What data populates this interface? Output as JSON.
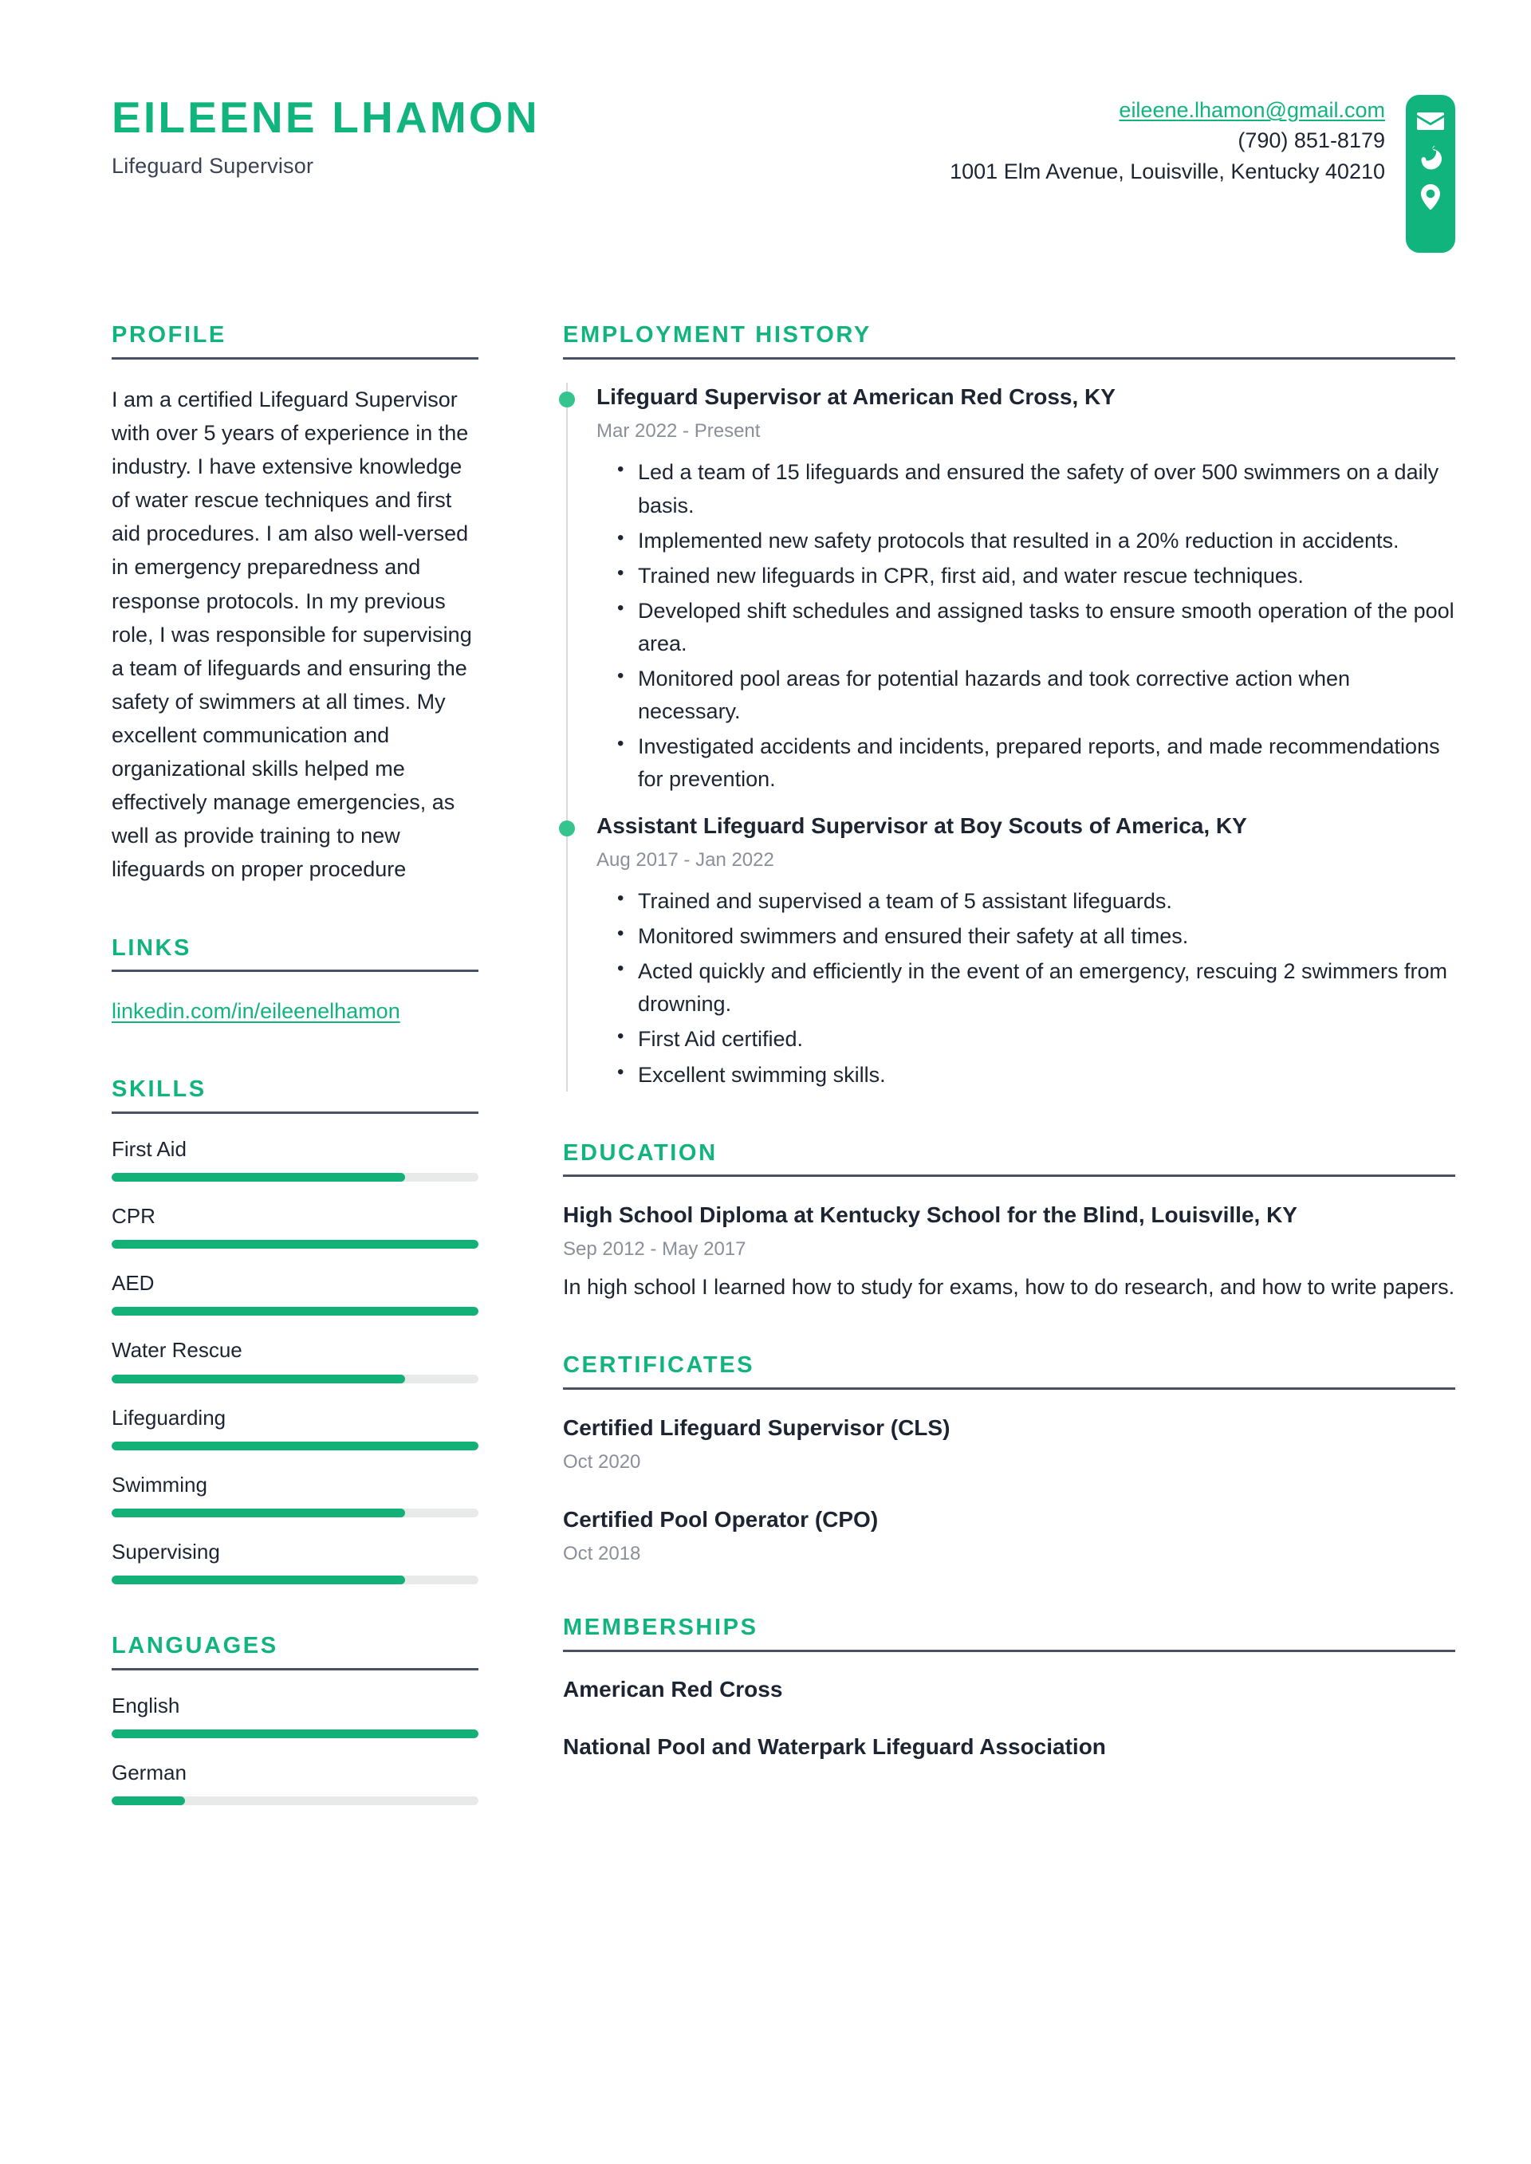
{
  "header": {
    "full_name": "EILEENE LHAMON",
    "job_title": "Lifeguard Supervisor",
    "contact": {
      "email": "eileene.lhamon@gmail.com",
      "phone": "(790) 851-8179",
      "address": "1001 Elm Avenue, Louisville, Kentucky 40210"
    },
    "icons": [
      "envelope-icon",
      "phone-icon",
      "location-pin-icon"
    ]
  },
  "colors": {
    "accent_green": "#12b47d",
    "bar_fill_green": "#13b177",
    "bar_track_gray": "#e8eaea",
    "rule_dark": "#4a5263",
    "text_dark": "#1d2432",
    "muted_gray": "#8a8f99"
  },
  "left_column": {
    "profile": {
      "title": "PROFILE",
      "text": "I am a certified Lifeguard Supervisor with over 5 years of experience in the industry. I have extensive knowledge of water rescue techniques and first aid procedures. I am also well-versed in emergency preparedness and response protocols. In my previous role, I was responsible for supervising a team of lifeguards and ensuring the safety of swimmers at all times. My excellent communication and organizational skills helped me effectively manage emergencies, as well as provide training to new lifeguards on proper procedure"
    },
    "links": {
      "title": "LINKS",
      "items": [
        {
          "label": "linkedin.com/in/eileenelhamon"
        }
      ]
    },
    "skills": {
      "title": "SKILLS",
      "items": [
        {
          "label": "First Aid",
          "level": 80
        },
        {
          "label": "CPR",
          "level": 100
        },
        {
          "label": "AED",
          "level": 100
        },
        {
          "label": "Water Rescue",
          "level": 80
        },
        {
          "label": "Lifeguarding",
          "level": 100
        },
        {
          "label": "Swimming",
          "level": 80
        },
        {
          "label": "Supervising",
          "level": 80
        }
      ]
    },
    "languages": {
      "title": "LANGUAGES",
      "items": [
        {
          "label": "English",
          "level": 100
        },
        {
          "label": "German",
          "level": 20
        }
      ]
    }
  },
  "right_column": {
    "employment": {
      "title": "EMPLOYMENT HISTORY",
      "entries": [
        {
          "title": "Lifeguard Supervisor at American Red Cross, KY",
          "date": "Mar 2022 - Present",
          "bullets": [
            "Led a team of 15 lifeguards and ensured the safety of over 500 swimmers on a daily basis.",
            "Implemented new safety protocols that resulted in a 20% reduction in accidents.",
            "Trained new lifeguards in CPR, first aid, and water rescue techniques.",
            "Developed shift schedules and assigned tasks to ensure smooth operation of the pool area.",
            "Monitored pool areas for potential hazards and took corrective action when necessary.",
            "Investigated accidents and incidents, prepared reports, and made recommendations for prevention."
          ]
        },
        {
          "title": "Assistant Lifeguard Supervisor at Boy Scouts of America, KY",
          "date": "Aug 2017 - Jan 2022",
          "bullets": [
            "Trained and supervised a team of 5 assistant lifeguards.",
            "Monitored swimmers and ensured their safety at all times.",
            "Acted quickly and efficiently in the event of an emergency, rescuing 2 swimmers from drowning.",
            "First Aid certified.",
            "Excellent swimming skills."
          ]
        }
      ]
    },
    "education": {
      "title": "EDUCATION",
      "entries": [
        {
          "title": "High School Diploma at Kentucky School for the Blind, Louisville, KY",
          "date": "Sep 2012 - May 2017",
          "description": "In high school I learned how to study for exams, how to do research, and how to write papers."
        }
      ]
    },
    "certificates": {
      "title": "CERTIFICATES",
      "entries": [
        {
          "title": "Certified Lifeguard Supervisor (CLS)",
          "date": "Oct 2020"
        },
        {
          "title": "Certified Pool Operator (CPO)",
          "date": "Oct 2018"
        }
      ]
    },
    "memberships": {
      "title": "MEMBERSHIPS",
      "items": [
        {
          "label": "American Red Cross"
        },
        {
          "label": "National Pool and Waterpark Lifeguard Association"
        }
      ]
    }
  }
}
